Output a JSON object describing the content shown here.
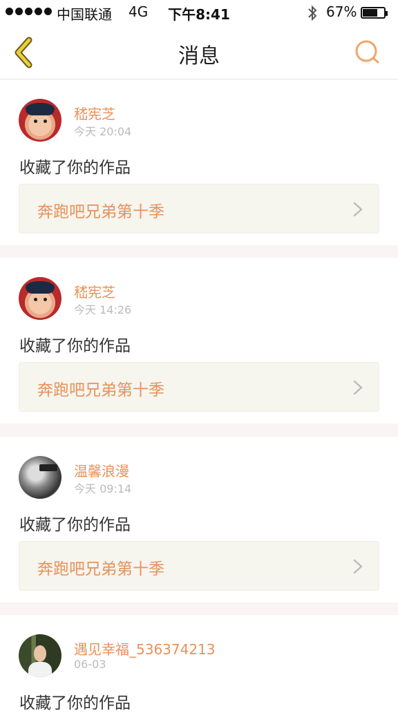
{
  "status_bar": {
    "carrier": "中国联通",
    "network": "4G",
    "time": "下午8:41",
    "battery": "67%",
    "battery_level": 0.67
  },
  "nav": {
    "title": "消息",
    "back_icon": "chevron-left-icon",
    "search_icon": "search-icon"
  },
  "colors": {
    "accent": "#e8915a",
    "back_icon": "#e8cf3c",
    "card_bg": "#f6f5ee",
    "separator": "#faf4f4"
  },
  "messages": [
    {
      "user": "嵇宪芝",
      "time": "今天 20:04",
      "action": "收藏了你的作品",
      "work": "奔跑吧兄弟第十季"
    },
    {
      "user": "嵇宪芝",
      "time": "今天 14:26",
      "action": "收藏了你的作品",
      "work": "奔跑吧兄弟第十季"
    },
    {
      "user": "温馨浪漫",
      "time": "今天 09:14",
      "action": "收藏了你的作品",
      "work": "奔跑吧兄弟第十季"
    },
    {
      "user": "遇见幸福_536374213",
      "time": "06-03",
      "action": "收藏了你的作品",
      "work": ""
    }
  ]
}
